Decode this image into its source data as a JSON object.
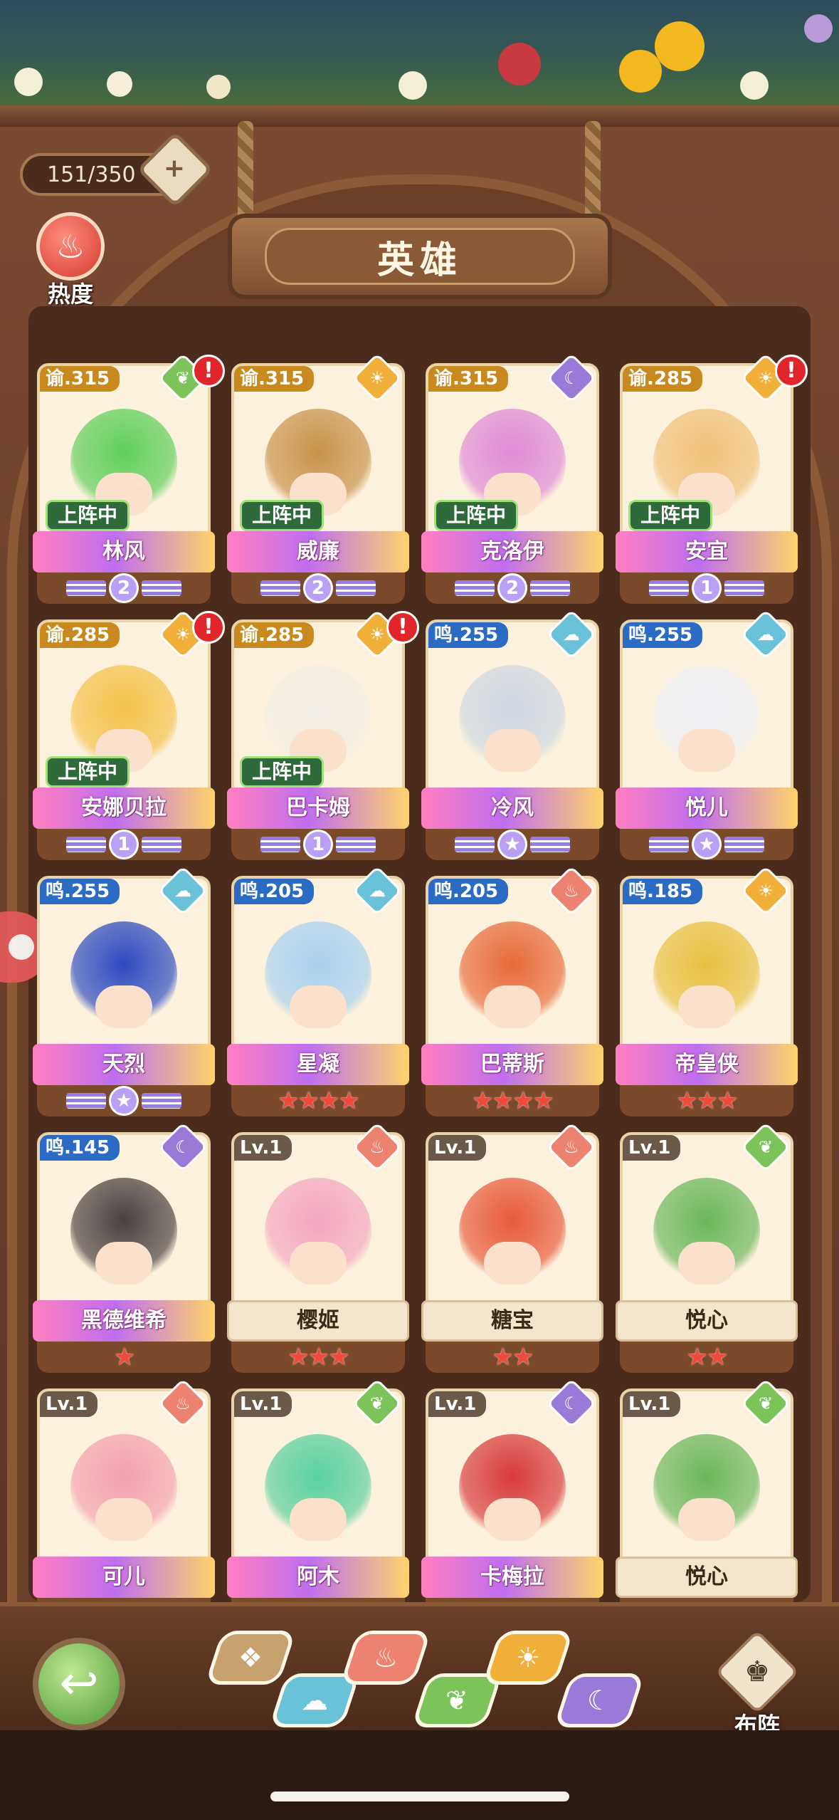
{
  "header": {
    "capacity": "151/350",
    "title": "英雄",
    "heat_label": "热度"
  },
  "cards": [
    {
      "tag": "谕.315",
      "tag_type": "yu",
      "element": "wood",
      "alert": "!",
      "status": "上阵中",
      "name": "林风",
      "rank": "2",
      "name_style": "rainbow",
      "color": "#5fcf5a"
    },
    {
      "tag": "谕.315",
      "tag_type": "yu",
      "element": "sun",
      "alert": "",
      "status": "上阵中",
      "name": "威廉",
      "rank": "2",
      "name_style": "rainbow",
      "color": "#c8924a"
    },
    {
      "tag": "谕.315",
      "tag_type": "yu",
      "element": "moon",
      "alert": "",
      "status": "上阵中",
      "name": "克洛伊",
      "rank": "2",
      "name_style": "rainbow",
      "color": "#e08ad8"
    },
    {
      "tag": "谕.285",
      "tag_type": "yu",
      "element": "sun",
      "alert": "!",
      "status": "上阵中",
      "name": "安宜",
      "rank": "1",
      "name_style": "rainbow",
      "color": "#f0c078"
    },
    {
      "tag": "谕.285",
      "tag_type": "yu",
      "element": "sun",
      "alert": "!",
      "status": "上阵中",
      "name": "安娜贝拉",
      "rank": "1",
      "name_style": "rainbow",
      "color": "#f4c24a"
    },
    {
      "tag": "谕.285",
      "tag_type": "yu",
      "element": "sun",
      "alert": "!",
      "status": "上阵中",
      "name": "巴卡姆",
      "rank": "1",
      "name_style": "rainbow",
      "color": "#f2ede4"
    },
    {
      "tag": "鸣.255",
      "tag_type": "ming",
      "element": "water",
      "alert": "",
      "status": "",
      "name": "冷风",
      "rank": "",
      "name_style": "rainbow",
      "color": "#cfd8e4"
    },
    {
      "tag": "鸣.255",
      "tag_type": "ming",
      "element": "water",
      "alert": "",
      "status": "",
      "name": "悦儿",
      "rank": "",
      "name_style": "rainbow",
      "color": "#eef0f6"
    },
    {
      "tag": "鸣.255",
      "tag_type": "ming",
      "element": "water",
      "alert": "",
      "status": "",
      "name": "天烈",
      "rank": "",
      "name_style": "rainbow",
      "color": "#2c4ac0"
    },
    {
      "tag": "鸣.205",
      "tag_type": "ming",
      "element": "water",
      "alert": "",
      "status": "",
      "name": "星凝",
      "rank": "",
      "stars": "★★★★",
      "name_style": "rainbow",
      "color": "#a8d0f0"
    },
    {
      "tag": "鸣.205",
      "tag_type": "ming",
      "element": "fire",
      "alert": "",
      "status": "",
      "name": "巴蒂斯",
      "rank": "",
      "stars": "★★★★",
      "name_style": "rainbow",
      "color": "#e86a3a"
    },
    {
      "tag": "鸣.185",
      "tag_type": "ming",
      "element": "sun",
      "alert": "",
      "status": "",
      "name": "帝皇侠",
      "rank": "",
      "stars": "★★★",
      "name_style": "rainbow",
      "color": "#e8c040"
    },
    {
      "tag": "鸣.145",
      "tag_type": "ming",
      "element": "moon",
      "alert": "",
      "status": "",
      "name": "黑德维希",
      "rank": "",
      "stars": "★",
      "name_style": "rainbow",
      "color": "#4a4040"
    },
    {
      "tag": "Lv.1",
      "tag_type": "lv",
      "element": "fire",
      "alert": "",
      "status": "",
      "name": "樱姬",
      "rank": "",
      "stars": "★★★",
      "name_style": "plain",
      "color": "#f4a6c0"
    },
    {
      "tag": "Lv.1",
      "tag_type": "lv",
      "element": "fire",
      "alert": "",
      "status": "",
      "name": "糖宝",
      "rank": "",
      "stars": "★★",
      "name_style": "plain",
      "color": "#e85a3a"
    },
    {
      "tag": "Lv.1",
      "tag_type": "lv",
      "element": "wood",
      "alert": "",
      "status": "",
      "name": "悦心",
      "rank": "",
      "stars": "★★",
      "name_style": "plain",
      "color": "#6ab85a"
    },
    {
      "tag": "Lv.1",
      "tag_type": "lv",
      "element": "fire",
      "alert": "",
      "status": "",
      "name": "可儿",
      "rank": "",
      "stars": "",
      "name_style": "rainbow",
      "color": "#f4a0b0"
    },
    {
      "tag": "Lv.1",
      "tag_type": "lv",
      "element": "wood",
      "alert": "",
      "status": "",
      "name": "阿木",
      "rank": "",
      "stars": "",
      "name_style": "rainbow",
      "color": "#5ad0a0"
    },
    {
      "tag": "Lv.1",
      "tag_type": "lv",
      "element": "moon",
      "alert": "",
      "status": "",
      "name": "卡梅拉",
      "rank": "",
      "stars": "",
      "name_style": "rainbow",
      "color": "#d83a3a"
    },
    {
      "tag": "Lv.1",
      "tag_type": "lv",
      "element": "wood",
      "alert": "",
      "status": "",
      "name": "悦心",
      "rank": "",
      "stars": "",
      "name_style": "plain",
      "color": "#6ab85a"
    }
  ],
  "toolbar": {
    "back_icon": "↩",
    "formation_label": "布阵",
    "formation_icon": "♚",
    "filters": [
      {
        "name": "all",
        "icon": "❖",
        "color": "#c8a26e"
      },
      {
        "name": "water",
        "icon": "☁",
        "color": "#6ac2d8"
      },
      {
        "name": "fire",
        "icon": "♨",
        "color": "#ee8270"
      },
      {
        "name": "wood",
        "icon": "❦",
        "color": "#7cc45a"
      },
      {
        "name": "sun",
        "icon": "☀",
        "color": "#f0b03a"
      },
      {
        "name": "moon",
        "icon": "☾",
        "color": "#9a7ad8"
      }
    ]
  },
  "element_icons": {
    "wood": "❦",
    "sun": "☀",
    "moon": "☾",
    "water": "☁",
    "fire": "♨"
  }
}
